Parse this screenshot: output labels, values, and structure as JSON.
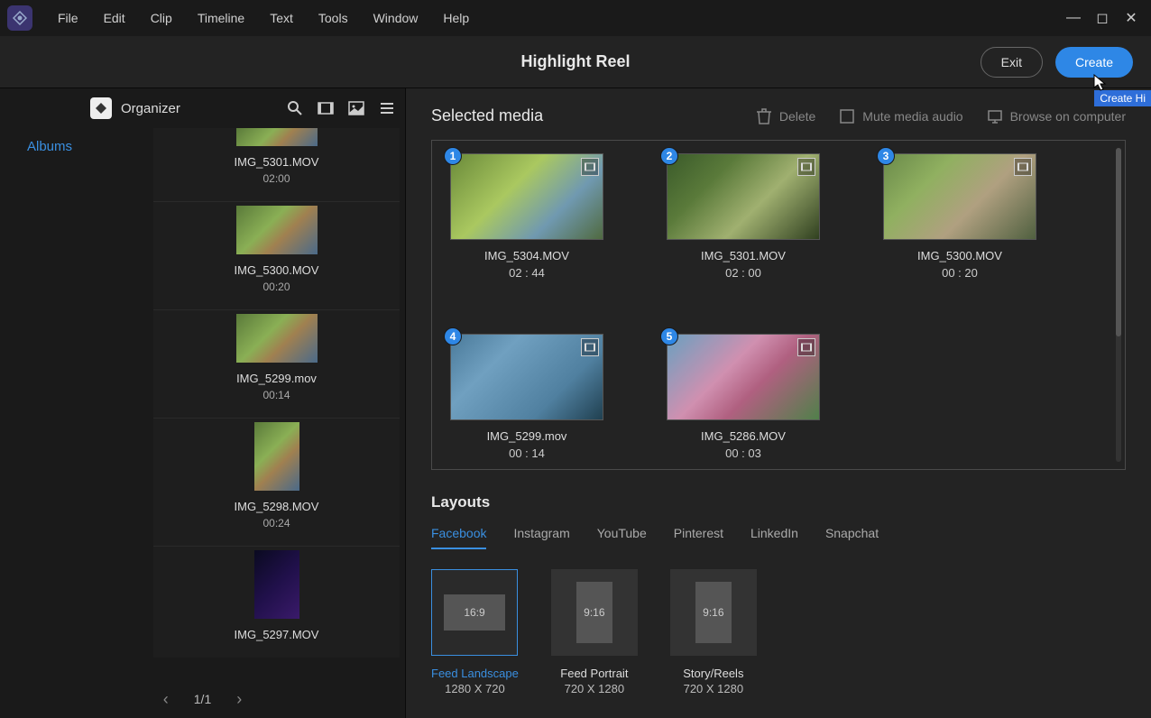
{
  "menu": [
    "File",
    "Edit",
    "Clip",
    "Timeline",
    "Text",
    "Tools",
    "Window",
    "Help"
  ],
  "titlebar": {
    "title": "Highlight Reel",
    "exit": "Exit",
    "create": "Create"
  },
  "tooltip": "Create Hi",
  "organizer": {
    "label": "Organizer",
    "albums": "Albums"
  },
  "media_list": [
    {
      "name": "IMG_5301.MOV",
      "dur": "02:00",
      "shape": "partial"
    },
    {
      "name": "IMG_5300.MOV",
      "dur": "00:20",
      "shape": "w"
    },
    {
      "name": "IMG_5299.mov",
      "dur": "00:14",
      "shape": "w"
    },
    {
      "name": "IMG_5298.MOV",
      "dur": "00:24",
      "shape": "p"
    },
    {
      "name": "IMG_5297.MOV",
      "dur": "",
      "shape": "p",
      "dark": true,
      "partialBottom": true
    }
  ],
  "pager": {
    "prev": "‹",
    "label": "1/1",
    "next": "›"
  },
  "selected": {
    "title": "Selected media",
    "actions": {
      "delete": "Delete",
      "mute": "Mute media audio",
      "browse": "Browse on computer"
    },
    "items": [
      {
        "n": "1",
        "name": "IMG_5304.MOV",
        "dur": "02 : 44",
        "cls": ""
      },
      {
        "n": "2",
        "name": "IMG_5301.MOV",
        "dur": "02 : 00",
        "cls": "t2"
      },
      {
        "n": "3",
        "name": "IMG_5300.MOV",
        "dur": "00 : 20",
        "cls": "t3"
      },
      {
        "n": "4",
        "name": "IMG_5299.mov",
        "dur": "00 : 14",
        "cls": "t4"
      },
      {
        "n": "5",
        "name": "IMG_5286.MOV",
        "dur": "00 : 03",
        "cls": "t5"
      }
    ]
  },
  "layouts": {
    "title": "Layouts",
    "tabs": [
      "Facebook",
      "Instagram",
      "YouTube",
      "Pinterest",
      "LinkedIn",
      "Snapchat"
    ],
    "activeTab": 0,
    "cards": [
      {
        "name": "Feed Landscape",
        "size": "1280 X 720",
        "ratio": "16:9",
        "cls": "ratio-169",
        "active": true
      },
      {
        "name": "Feed Portrait",
        "size": "720 X 1280",
        "ratio": "9:16",
        "cls": "ratio-916",
        "active": false
      },
      {
        "name": "Story/Reels",
        "size": "720 X 1280",
        "ratio": "9:16",
        "cls": "ratio-916",
        "active": false
      }
    ]
  }
}
